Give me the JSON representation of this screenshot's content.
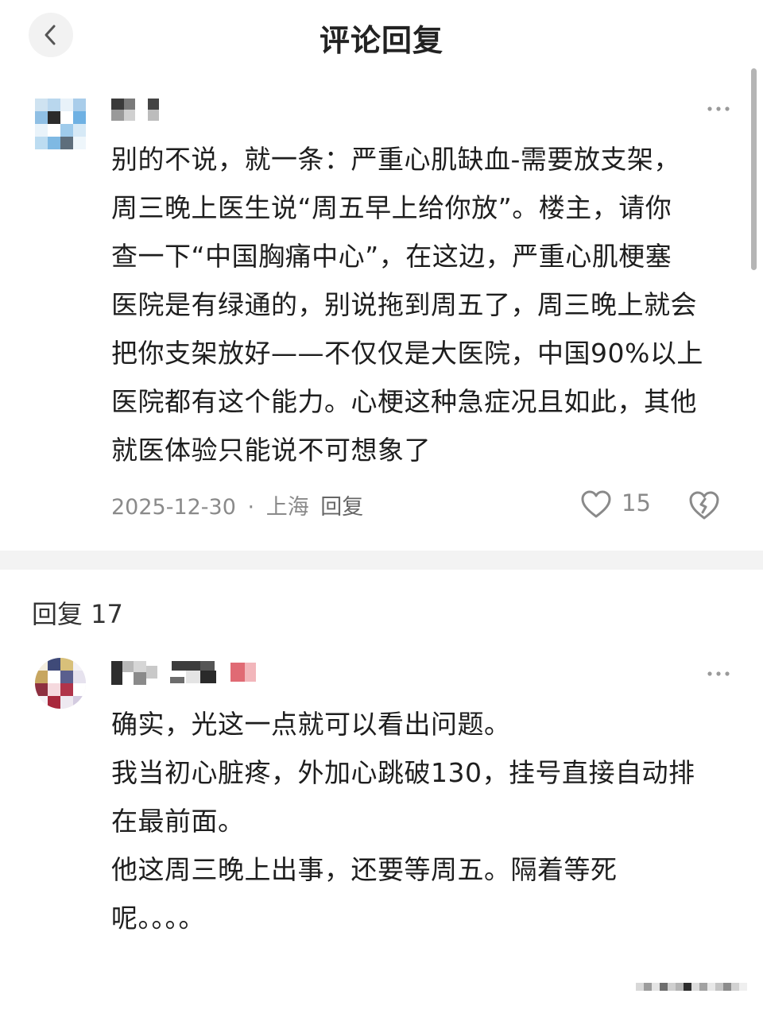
{
  "header": {
    "title": "评论回复",
    "back_icon": "chevron-left-icon"
  },
  "main_comment": {
    "lines": [
      "别的不说，就一条：严重心肌缺血-需要放支架，",
      "周三晚上医生说“周五早上给你放”。楼主，请你",
      "查一下“中国胸痛中心”，在这边，严重心肌梗塞",
      "医院是有绿通的，别说拖到周五了，周三晚上就会",
      "把你支架放好——不仅仅是大医院，中国90%以上",
      "医院都有这个能力。心梗这种急症况且如此，其他",
      "就医体验只能说不可想象了"
    ],
    "date": "2025-12-30",
    "separator": "·",
    "location": "上海",
    "reply_label": "回复",
    "like_count": "15",
    "like_icon": "heart-icon",
    "dislike_icon": "broken-heart-icon",
    "more_icon": "more-dots-icon"
  },
  "replies": {
    "heading": "回复 17",
    "items": [
      {
        "lines": [
          "确实，光这一点就可以看出问题。",
          "我当初心脏疼，外加心跳破130，挂号直接自动排",
          "在最前面。",
          "他这周三晚上出事，还要等周五。隔着等死",
          "呢。。。。"
        ],
        "more_icon": "more-dots-icon"
      }
    ]
  },
  "colors": {
    "text": "#1e1e1e",
    "meta": "#8a8a8a",
    "divider": "#f3f3f3",
    "back_button_bg": "#f2f2f2"
  }
}
